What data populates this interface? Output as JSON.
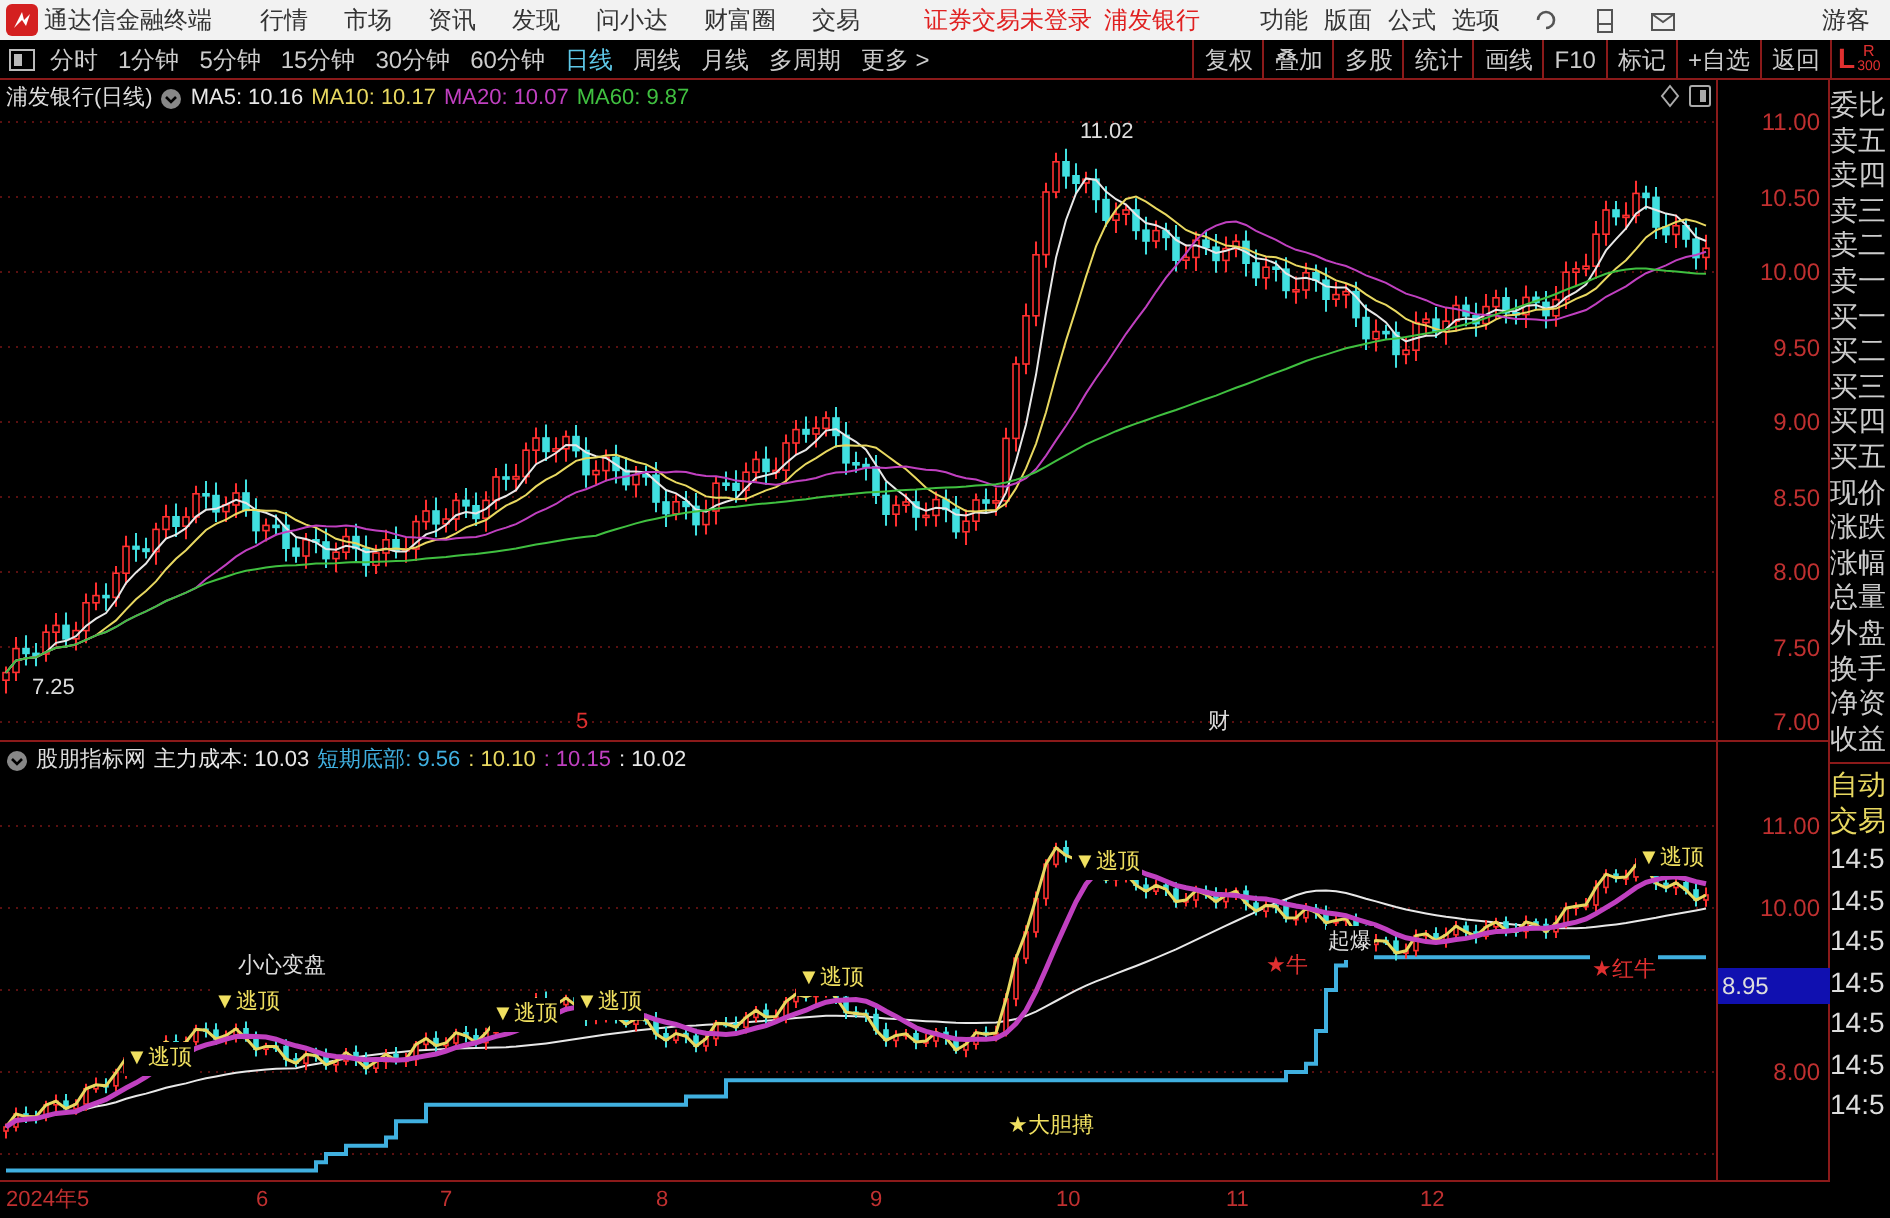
{
  "app": {
    "title": "通达信金融终端"
  },
  "menu": [
    "行情",
    "市场",
    "资讯",
    "发现",
    "问小达",
    "财富圈",
    "交易"
  ],
  "login_status": {
    "text": "证券交易未登录",
    "stock": "浦发银行"
  },
  "tools": [
    "功能",
    "版面",
    "公式",
    "选项"
  ],
  "user": "游客",
  "periods": [
    {
      "label": "分时",
      "selected": false
    },
    {
      "label": "1分钟",
      "selected": false
    },
    {
      "label": "5分钟",
      "selected": false
    },
    {
      "label": "15分钟",
      "selected": false
    },
    {
      "label": "30分钟",
      "selected": false
    },
    {
      "label": "60分钟",
      "selected": false
    },
    {
      "label": "日线",
      "selected": true
    },
    {
      "label": "周线",
      "selected": false
    },
    {
      "label": "月线",
      "selected": false
    },
    {
      "label": "多周期",
      "selected": false
    },
    {
      "label": "更多 >",
      "selected": false
    }
  ],
  "actions": [
    "复权",
    "叠加",
    "多股",
    "统计",
    "画线",
    "F10",
    "标记",
    "+自选",
    "返回"
  ],
  "level_badge": {
    "letter": "L",
    "sub_letter": "R",
    "sub_number": "300"
  },
  "price_pane": {
    "title": "浦发银行(日线)",
    "indicators": [
      {
        "label": "MA5: 10.16",
        "color": "#e8e8e8"
      },
      {
        "label": "MA10: 10.17",
        "color": "#e8d860"
      },
      {
        "label": "MA20: 10.07",
        "color": "#c040c0"
      },
      {
        "label": "MA60: 9.87",
        "color": "#40c040"
      }
    ],
    "high_mark": "11.02",
    "low_mark": "7.25",
    "event_marks": [
      {
        "text": "5",
        "kind": "dividend"
      },
      {
        "text": "财",
        "kind": "report"
      }
    ],
    "yticks": [
      "11.00",
      "10.50",
      "10.00",
      "9.50",
      "9.00",
      "8.50",
      "8.00",
      "7.50",
      "7.00"
    ]
  },
  "indicator_pane": {
    "title": "股朋指标网",
    "values": [
      {
        "label": "主力成本: 10.03",
        "color": "#e8e8e8"
      },
      {
        "label": "短期底部: 9.56",
        "color": "#40b0e0"
      },
      {
        "label": ": 10.10",
        "color": "#e8d860"
      },
      {
        "label": ": 10.15",
        "color": "#c040c0"
      },
      {
        "label": ": 10.02",
        "color": "#e8e8e8"
      }
    ],
    "signals": [
      {
        "text": "▼逃顶",
        "kind": "top"
      },
      {
        "text": "小心变盘",
        "kind": "warn"
      },
      {
        "text": "▼逃顶",
        "kind": "top"
      },
      {
        "text": "▼逃顶",
        "kind": "top"
      },
      {
        "text": "▼逃顶",
        "kind": "top"
      },
      {
        "text": "▼逃顶",
        "kind": "top"
      },
      {
        "text": "★大胆搏",
        "kind": "bold"
      },
      {
        "text": "▼逃顶",
        "kind": "top"
      },
      {
        "text": "★牛",
        "kind": "bull"
      },
      {
        "text": "起爆",
        "kind": "start"
      },
      {
        "text": "▼逃顶",
        "kind": "top"
      },
      {
        "text": "★红牛",
        "kind": "bull"
      }
    ],
    "yticks": [
      "11.00",
      "10.00",
      "8.00"
    ],
    "cursor_value": "8.95"
  },
  "xaxis": [
    "2024年5",
    "6",
    "7",
    "8",
    "9",
    "10",
    "11",
    "12"
  ],
  "quote_labels": [
    "委比",
    "卖五",
    "卖四",
    "卖三",
    "卖二",
    "卖一",
    "买一",
    "买二",
    "买三",
    "买四",
    "买五",
    "现价",
    "涨跌",
    "涨幅",
    "总量",
    "外盘",
    "换手",
    "净资",
    "收益"
  ],
  "trade_panel": {
    "title_lines": [
      "自动",
      "交易"
    ],
    "times": [
      "14:5",
      "14:5",
      "14:5",
      "14:5",
      "14:5",
      "14:5",
      "14:5"
    ]
  }
}
